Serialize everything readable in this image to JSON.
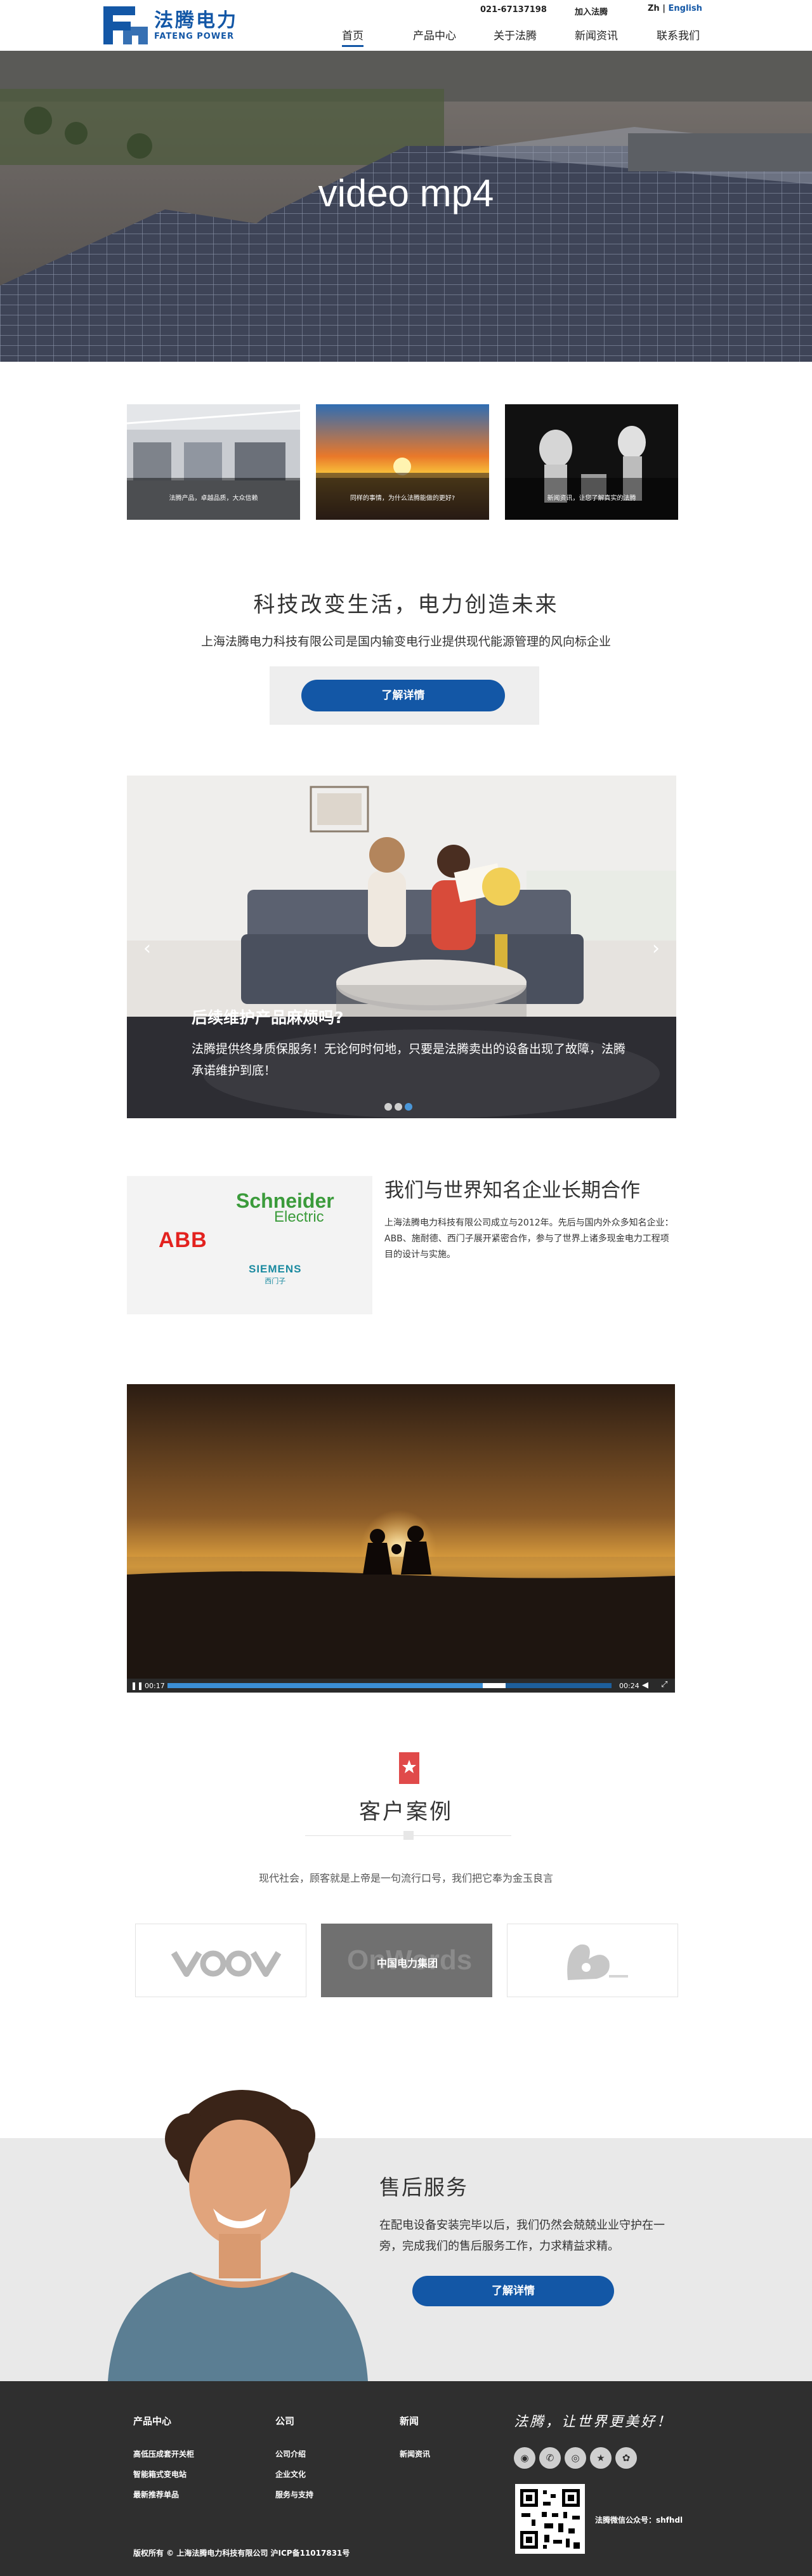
{
  "header": {
    "logo_cn": "法腾电力",
    "logo_en": "FATENG POWER",
    "phone": "021-67137198",
    "join": "加入法腾",
    "lang_zh": "Zh",
    "lang_sep": "|",
    "lang_en": "English",
    "nav": [
      {
        "label": "首页",
        "active": true
      },
      {
        "label": "产品中心",
        "active": false
      },
      {
        "label": "关于法腾",
        "active": false
      },
      {
        "label": "新闻资讯",
        "active": false
      },
      {
        "label": "联系我们",
        "active": false
      }
    ]
  },
  "hero": {
    "title": "video mp4"
  },
  "thumbs": [
    {
      "caption": "法腾产品，卓越品质，大众信赖"
    },
    {
      "caption": "同样的事情，为什么法腾能做的更好?"
    },
    {
      "caption": "新闻资讯，让您了解真实的法腾"
    }
  ],
  "slogan": {
    "title": "科技改变生活，电力创造未来",
    "subtitle": "上海法腾电力科技有限公司是国内输变电行业提供现代能源管理的风向标企业",
    "button": "了解详情"
  },
  "carousel": {
    "title": "后续维护产品麻烦吗?",
    "text": "法腾提供终身质保服务！无论何时何地，只要是法腾卖出的设备出现了故障，法腾承诺维护到底！",
    "prev": "‹",
    "next": "›",
    "dots": [
      false,
      false,
      true
    ]
  },
  "partners": {
    "logos": {
      "abb": "ABB",
      "schneider_1": "Schneider",
      "schneider_2": "Electric",
      "siemens": "SIEMENS",
      "siemens_cn": "西门子"
    },
    "title": "我们与世界知名企业长期合作",
    "text": "上海法腾电力科技有限公司成立与2012年。先后与国内外众多知名企业：ABB、施耐德、西门子展开紧密合作，参与了世界上诸多现金电力工程项目的设计与实施。"
  },
  "video": {
    "time_current": "00:17",
    "time_total": "00:24",
    "progress": 0.71
  },
  "cases": {
    "title": "客户案例",
    "subtitle": "现代社会，顾客就是上帝是一句流行口号，我们把它奉为金玉良言",
    "cards": [
      {
        "label": "",
        "logo": "voov"
      },
      {
        "label": "中国电力集团",
        "logo": "onwords",
        "logo_text": "OnWords"
      },
      {
        "label": "",
        "logo": "flower"
      }
    ]
  },
  "service": {
    "title": "售后服务",
    "text": "在配电设备安装完毕以后，我们仍然会兢兢业业守护在一旁，完成我们的售后服务工作，力求精益求精。",
    "button": "了解详情"
  },
  "footer": {
    "columns": [
      {
        "title": "产品中心",
        "links": [
          "高低压成套开关柜",
          "智能箱式变电站",
          "最新推荐单品"
        ]
      },
      {
        "title": "公司",
        "links": [
          "公司介绍",
          "企业文化",
          "服务与支持"
        ]
      },
      {
        "title": "新闻",
        "links": [
          "新闻资讯"
        ]
      }
    ],
    "slogan": "法腾，让世界更美好！",
    "social": [
      "qq-icon",
      "wechat-icon",
      "weibo-icon",
      "star-icon",
      "flower-icon"
    ],
    "qr_label": "法腾微信公众号：shfhdl",
    "copyright": "版权所有 © 上海法腾电力科技有限公司 沪ICP备11017831号"
  }
}
